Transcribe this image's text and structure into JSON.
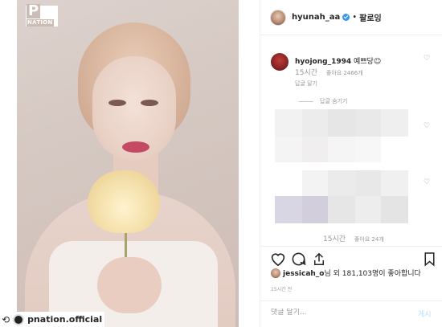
{
  "photo": {
    "logo_big": "P",
    "logo_small": "NATION"
  },
  "repost": {
    "credit_name": "pnation.official"
  },
  "header": {
    "username": "hyunah_aa",
    "dot": "•",
    "follow_label": "팔로잉"
  },
  "comment": {
    "username": "hyojong_1994",
    "text": "예쁘당☺",
    "time": "15시간",
    "likes": "좋아요 2466개",
    "reply_label": "답글 달기"
  },
  "hide_replies_label": "답글 숨기기",
  "blurred_footer": {
    "time": "15시간",
    "likes": "좋아요 24개"
  },
  "likes_line": {
    "user": "jessicah_o",
    "text": "님 외 181,103명이 좋아합니다"
  },
  "timestamp": "15시간 전",
  "comment_box": {
    "placeholder": "댓글 달기...",
    "post_label": "게시"
  },
  "icons": {
    "heart": "heart-icon",
    "comment": "comment-icon",
    "share": "share-icon",
    "bookmark": "bookmark-icon",
    "repost": "repost-icon",
    "verified": "verified-badge-icon"
  },
  "colors": {
    "verified": "#3897f0",
    "post_disabled": "#b3dbff",
    "muted": "#999999"
  }
}
